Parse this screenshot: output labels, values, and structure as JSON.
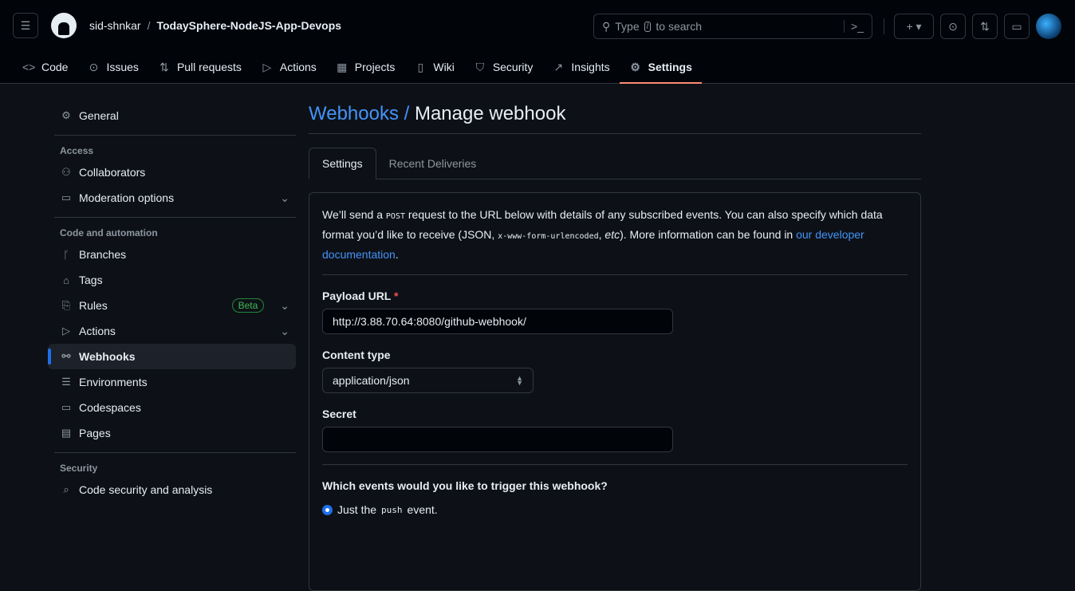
{
  "header": {
    "owner": "sid-shnkar",
    "separator": "/",
    "repo": "TodaySphere-NodeJS-App-Devops",
    "search_prefix": "Type",
    "search_key": "/",
    "search_suffix": "to search"
  },
  "tabs": [
    {
      "label": "Code",
      "icon": "code-icon",
      "g": "<>"
    },
    {
      "label": "Issues",
      "icon": "issue-icon",
      "g": "⊙"
    },
    {
      "label": "Pull requests",
      "icon": "pull-request-icon",
      "g": "⇅"
    },
    {
      "label": "Actions",
      "icon": "play-icon",
      "g": "▷"
    },
    {
      "label": "Projects",
      "icon": "table-icon",
      "g": "▦"
    },
    {
      "label": "Wiki",
      "icon": "book-icon",
      "g": "▯"
    },
    {
      "label": "Security",
      "icon": "shield-icon",
      "g": "⛉"
    },
    {
      "label": "Insights",
      "icon": "graph-icon",
      "g": "↗"
    },
    {
      "label": "Settings",
      "icon": "gear-icon",
      "g": "⚙"
    }
  ],
  "sidebar": {
    "general": "General",
    "access_heading": "Access",
    "collaborators": "Collaborators",
    "moderation": "Moderation options",
    "code_heading": "Code and automation",
    "branches": "Branches",
    "tags": "Tags",
    "rules": "Rules",
    "beta": "Beta",
    "actions": "Actions",
    "webhooks": "Webhooks",
    "environments": "Environments",
    "codespaces": "Codespaces",
    "pages": "Pages",
    "security_heading": "Security",
    "code_security": "Code security and analysis"
  },
  "main": {
    "crumb": "Webhooks /",
    "title": "Manage webhook",
    "tab_settings": "Settings",
    "tab_deliveries": "Recent Deliveries",
    "intro_1": "We’ll send a ",
    "intro_post": "POST",
    "intro_2": " request to the URL below with details of any subscribed events. You can also specify which data format you’d like to receive (JSON, ",
    "intro_code": "x-www-form-urlencoded",
    "intro_3": ", ",
    "intro_etc": "etc",
    "intro_4": "). More information can be found in ",
    "intro_link": "our developer documentation",
    "intro_5": ".",
    "payload_label": "Payload URL",
    "required": "*",
    "payload_value": "http://3.88.70.64:8080/github-webhook/",
    "content_label": "Content type",
    "content_value": "application/json",
    "secret_label": "Secret",
    "secret_value": "",
    "events_question": "Which events would you like to trigger this webhook?",
    "radio_1": "Just the ",
    "radio_code": "push",
    "radio_2": " event."
  }
}
